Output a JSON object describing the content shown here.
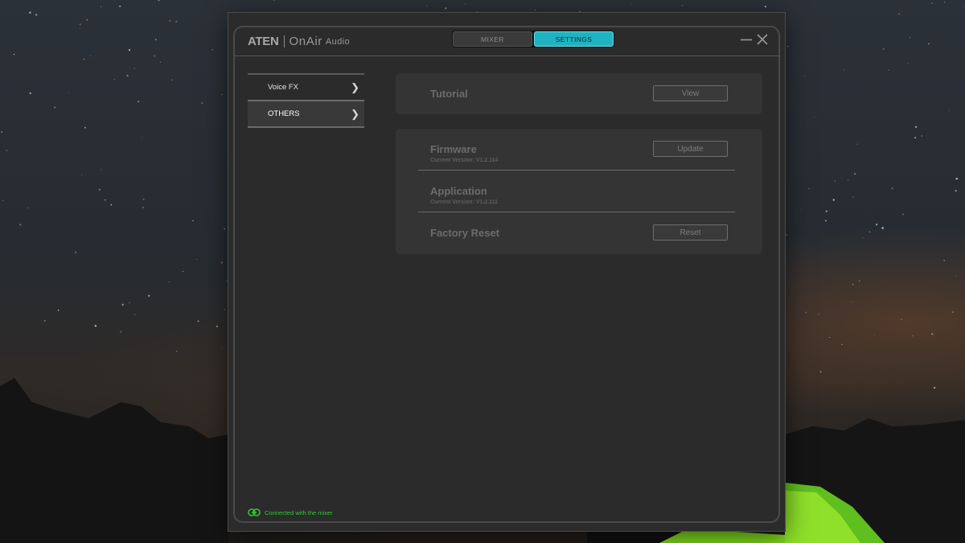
{
  "app": {
    "logo_brand": "ATEN",
    "logo_product": "OnAir",
    "logo_suffix": "Audio"
  },
  "tabs": [
    {
      "label": "MIXER",
      "active": false
    },
    {
      "label": "SETTINGS",
      "active": true
    }
  ],
  "window_controls": {
    "minimize_icon": "minimize-icon",
    "close_icon": "close-icon"
  },
  "sidebar": {
    "items": [
      {
        "label": "Voice FX",
        "active": false
      },
      {
        "label": "OTHERS",
        "active": true
      }
    ]
  },
  "tutorial": {
    "title": "Tutorial",
    "button_label": "View"
  },
  "firmware": {
    "title": "Firmware",
    "version": "Current Version: V1.2.114",
    "button_label": "Update"
  },
  "application": {
    "title": "Application",
    "version": "Current Version: V1.2.111"
  },
  "factory_reset": {
    "title": "Factory Reset",
    "button_label": "Reset"
  },
  "status": {
    "text": "Connected with the mixer",
    "icon": "link-icon",
    "color": "#2ecc2e"
  },
  "colors": {
    "accent": "#1fb3c2",
    "window_bg": "#2b2b2b",
    "panel_bg": "#343434"
  }
}
